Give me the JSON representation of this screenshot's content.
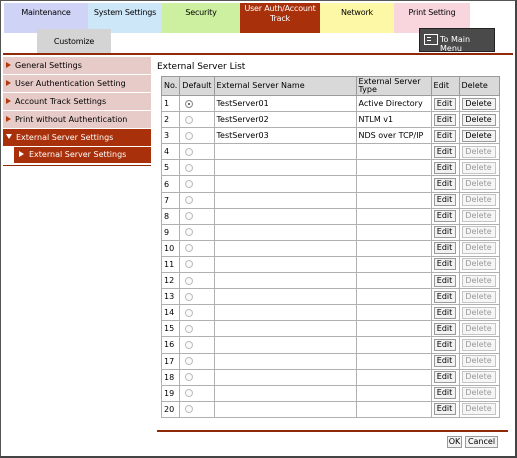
{
  "tabs": {
    "maintenance": "Maintenance",
    "system_settings": "System Settings",
    "security": "Security",
    "user_auth_line1": "User Auth/Account",
    "user_auth_line2": "Track",
    "network": "Network",
    "print_setting": "Print Setting",
    "customize": "Customize"
  },
  "main_menu_label": "To Main Menu",
  "sidebar": {
    "items": [
      {
        "label": "General Settings"
      },
      {
        "label": "User Authentication Setting"
      },
      {
        "label": "Account Track Settings"
      },
      {
        "label": "Print without Authentication"
      },
      {
        "label": "External Server Settings"
      }
    ],
    "sub_item": "External Server Settings"
  },
  "list_title": "External Server List",
  "table": {
    "headers": {
      "no": "No.",
      "default": "Default",
      "name": "External Server Name",
      "type_line1": "External Server",
      "type_line2": "Type",
      "edit": "Edit",
      "delete": "Delete"
    },
    "edit_label": "Edit",
    "delete_label": "Delete",
    "rows": [
      {
        "no": "1",
        "name": "TestServer01",
        "type": "Active Directory",
        "default": true,
        "deletable": true
      },
      {
        "no": "2",
        "name": "TestServer02",
        "type": "NTLM v1",
        "default": false,
        "deletable": true
      },
      {
        "no": "3",
        "name": "TestServer03",
        "type": "NDS over TCP/IP",
        "default": false,
        "deletable": true
      },
      {
        "no": "4",
        "name": "",
        "type": "",
        "default": false,
        "deletable": false
      },
      {
        "no": "5",
        "name": "",
        "type": "",
        "default": false,
        "deletable": false
      },
      {
        "no": "6",
        "name": "",
        "type": "",
        "default": false,
        "deletable": false
      },
      {
        "no": "7",
        "name": "",
        "type": "",
        "default": false,
        "deletable": false
      },
      {
        "no": "8",
        "name": "",
        "type": "",
        "default": false,
        "deletable": false
      },
      {
        "no": "9",
        "name": "",
        "type": "",
        "default": false,
        "deletable": false
      },
      {
        "no": "10",
        "name": "",
        "type": "",
        "default": false,
        "deletable": false
      },
      {
        "no": "11",
        "name": "",
        "type": "",
        "default": false,
        "deletable": false
      },
      {
        "no": "12",
        "name": "",
        "type": "",
        "default": false,
        "deletable": false
      },
      {
        "no": "13",
        "name": "",
        "type": "",
        "default": false,
        "deletable": false
      },
      {
        "no": "14",
        "name": "",
        "type": "",
        "default": false,
        "deletable": false
      },
      {
        "no": "15",
        "name": "",
        "type": "",
        "default": false,
        "deletable": false
      },
      {
        "no": "16",
        "name": "",
        "type": "",
        "default": false,
        "deletable": false
      },
      {
        "no": "17",
        "name": "",
        "type": "",
        "default": false,
        "deletable": false
      },
      {
        "no": "18",
        "name": "",
        "type": "",
        "default": false,
        "deletable": false
      },
      {
        "no": "19",
        "name": "",
        "type": "",
        "default": false,
        "deletable": false
      },
      {
        "no": "20",
        "name": "",
        "type": "",
        "default": false,
        "deletable": false
      }
    ]
  },
  "ok_label": "OK",
  "cancel_label": "Cancel",
  "colors": {
    "accent": "#a8300a",
    "sidebar_inactive": "#e7cbc8"
  }
}
